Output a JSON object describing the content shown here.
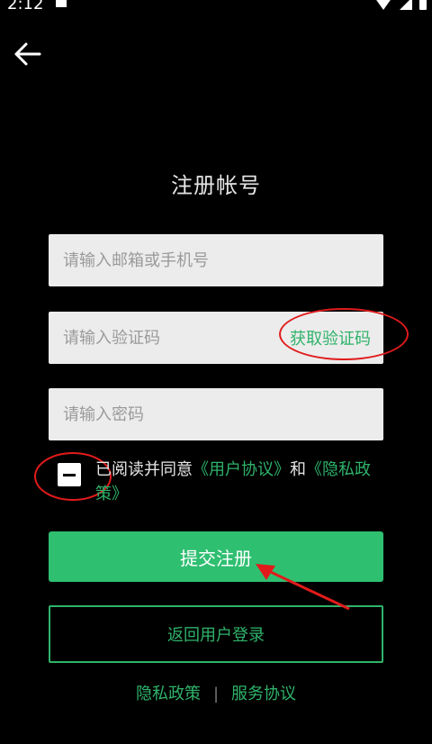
{
  "status": {
    "time": "2:12"
  },
  "page": {
    "title": "注册帐号"
  },
  "form": {
    "account_placeholder": "请输入邮箱或手机号",
    "code_placeholder": "请输入验证码",
    "get_code": "获取验证码",
    "password_placeholder": "请输入密码"
  },
  "agreement": {
    "prefix": "已阅读并同意",
    "user_agreement": "《用户协议》",
    "and": "和",
    "privacy_policy": "《隐私政策》"
  },
  "buttons": {
    "submit": "提交注册",
    "back_login": "返回用户登录"
  },
  "footer": {
    "privacy": "隐私政策",
    "separator": "|",
    "service": "服务协议"
  },
  "colors": {
    "accent": "#2fbf71",
    "annotation": "#e11b1b",
    "background": "#000000"
  }
}
